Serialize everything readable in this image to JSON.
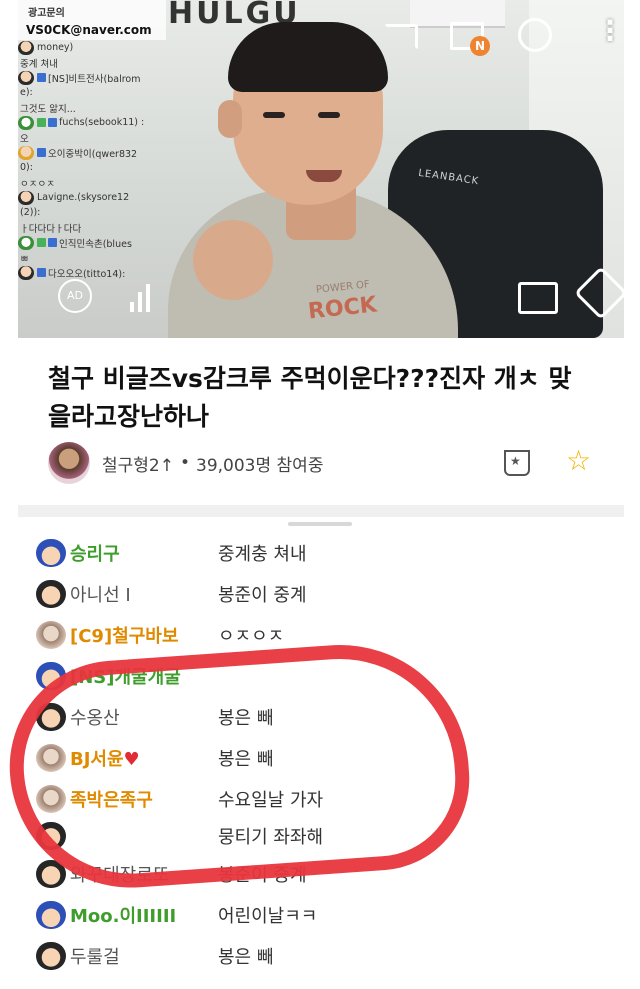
{
  "video": {
    "sign_text": "HULGU",
    "overlay_brand_name": "광고문의",
    "overlay_email": "VS0CK@naver.com",
    "overlay_chat": [
      {
        "text": "money)"
      },
      {
        "text": "중계 쳐내"
      },
      {
        "text": "[NS]비트전사(balrom"
      },
      {
        "text": "e):"
      },
      {
        "text": "그것도 앎지..."
      },
      {
        "text": "fuchs(sebook11) :"
      },
      {
        "text": "오"
      },
      {
        "text": "오이중박이(qwer832"
      },
      {
        "text": "0):"
      },
      {
        "text": "ㅇㅈㅇㅈ"
      },
      {
        "text": "Lavigne.(skysore12"
      },
      {
        "text": "(2)):"
      },
      {
        "text": "ㅏ다다다ㅏ다다"
      },
      {
        "text": "인직민속촌(blues"
      },
      {
        "text": "ㅃ"
      },
      {
        "text": "다오오오(titto14):"
      }
    ],
    "shirt_text": "ROCK",
    "shirt_sub": "POWER OF",
    "chair_text": "LEANBACK",
    "notif_badge": "N",
    "ad_label": "AD"
  },
  "broadcast": {
    "title": "철구 비글즈vs감크루 주먹이운다???진자 개ㅊ 맞을라고장난하나",
    "streamer": "철구형2↑",
    "viewers": "39,003명 참여중"
  },
  "chat": [
    {
      "nick": "승리구",
      "message": "중계충 쳐내",
      "nick_style": "green",
      "avatar": "cap"
    },
    {
      "nick": "아니선 I",
      "message": "봉준이 중계",
      "nick_style": "gray",
      "avatar": "boy"
    },
    {
      "nick": "[C9]철구바보",
      "message": "ㅇㅈㅇㅈ",
      "nick_style": "orange",
      "avatar": "sil"
    },
    {
      "nick": "[NS]개굴개굴",
      "message": "",
      "nick_style": "green",
      "avatar": "cap"
    },
    {
      "nick": "수옹산",
      "message": "봉은 빼",
      "nick_style": "gray",
      "avatar": "boy"
    },
    {
      "nick": "BJ서윤",
      "heart": "♥",
      "message": "봉은 빼",
      "nick_style": "orange",
      "avatar": "sil"
    },
    {
      "nick": "족박은족구",
      "message": "수요일날 가자",
      "nick_style": "orange",
      "avatar": "sil"
    },
    {
      "nick": "",
      "message": "뭉티기 좌좌해",
      "nick_style": "gray",
      "avatar": "boy"
    },
    {
      "nick": "와꾸대장로또",
      "message": "봉준이 중계",
      "nick_style": "gray",
      "avatar": "boy"
    },
    {
      "nick": "Moo.이IIIIII",
      "message": "어린이날ㅋㅋ",
      "nick_style": "green",
      "avatar": "cap"
    },
    {
      "nick": "두룰걸",
      "message": "봉은 빼",
      "nick_style": "gray",
      "avatar": "boy"
    }
  ],
  "colors": {
    "nick_green": "#3f9d2c",
    "nick_orange": "#e08a00",
    "annotation_red": "#e8353c",
    "star_yellow": "#f3b300"
  }
}
